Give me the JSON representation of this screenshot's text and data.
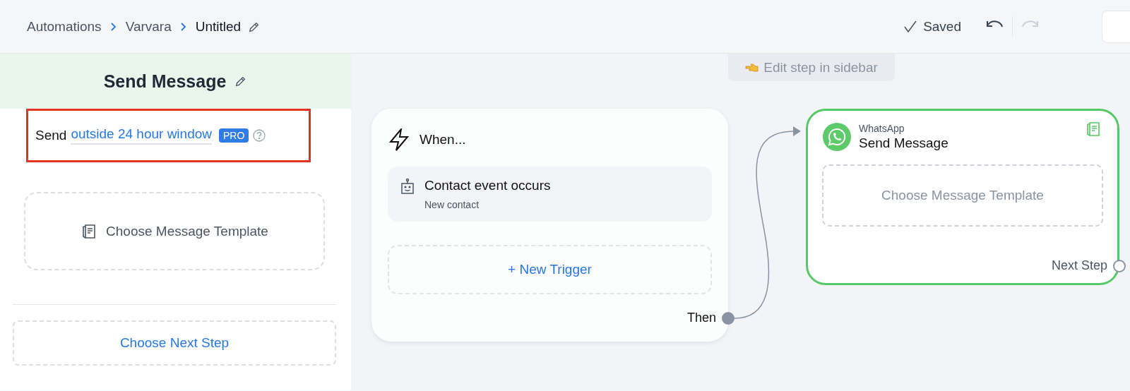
{
  "breadcrumb": {
    "items": [
      {
        "label": "Automations",
        "current": false
      },
      {
        "label": "Varvara",
        "current": false
      },
      {
        "label": "Untitled",
        "current": true
      }
    ]
  },
  "header": {
    "saved": "Saved",
    "undo": {
      "disabled": false
    },
    "redo": {
      "disabled": true
    }
  },
  "sidebar": {
    "title": "Send Message",
    "send_option": {
      "prefix": "Send",
      "link": "outside 24 hour window",
      "badge": "PRO"
    },
    "template_button": "Choose Message Template",
    "next_step_button": "Choose Next Step"
  },
  "canvas": {
    "hint": "Edit step in sidebar",
    "trigger_node": {
      "title": "When...",
      "events": [
        {
          "title": "Contact event occurs",
          "subtitle": "New contact"
        }
      ],
      "add_trigger": "+ New Trigger",
      "output": "Then"
    },
    "action_node": {
      "channel": "WhatsApp",
      "title": "Send Message",
      "selected": true,
      "template_placeholder": "Choose Message Template",
      "output": "Next Step"
    }
  }
}
